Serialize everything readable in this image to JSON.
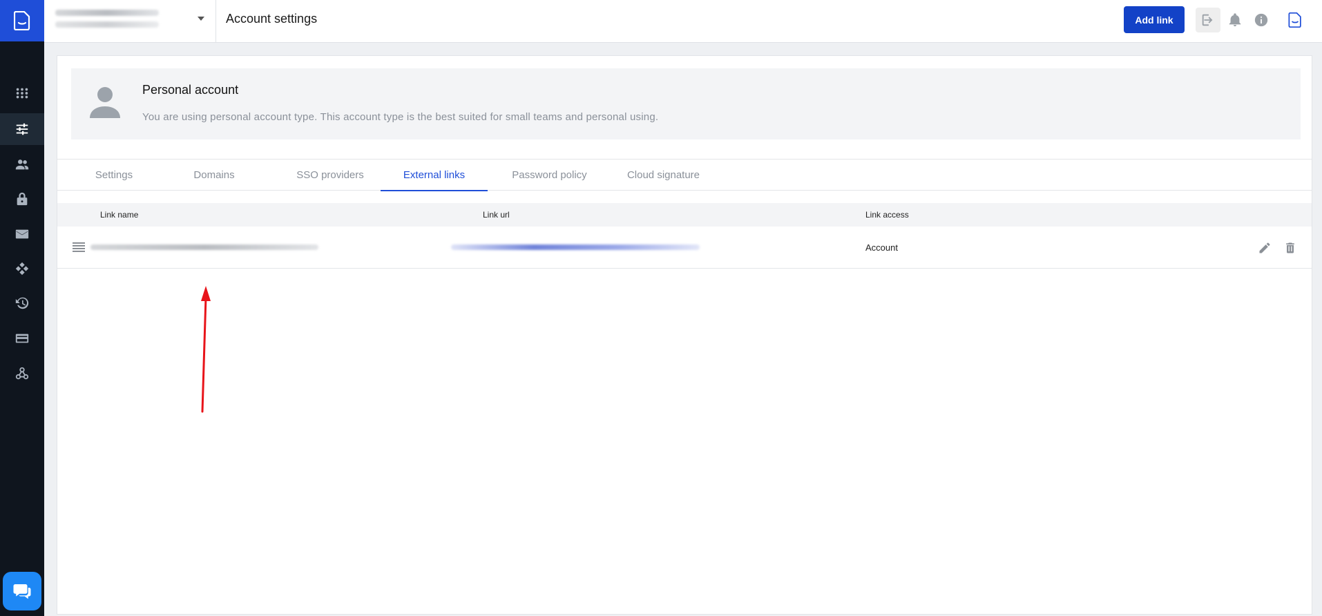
{
  "header": {
    "title": "Account settings",
    "add_link_label": "Add link"
  },
  "account": {
    "title": "Personal account",
    "description": "You are using personal account type. This account type is the best suited for small teams and personal using."
  },
  "tabs": [
    {
      "label": "Settings",
      "active": false
    },
    {
      "label": "Domains",
      "active": false
    },
    {
      "label": "SSO providers",
      "active": false
    },
    {
      "label": "External links",
      "active": true
    },
    {
      "label": "Password policy",
      "active": false
    },
    {
      "label": "Cloud signature",
      "active": false
    }
  ],
  "table": {
    "columns": [
      "Link name",
      "Link url",
      "Link access"
    ],
    "rows": [
      {
        "link_access": "Account"
      }
    ]
  },
  "sidebar_icons": [
    "apps-icon",
    "settings-sliders-icon",
    "users-icon",
    "lock-icon",
    "mail-icon",
    "integrations-icon",
    "history-icon",
    "billing-card-icon",
    "webhooks-icon"
  ],
  "colors": {
    "accent": "#1f4ed8",
    "button": "#1342c7",
    "sidebar": "#0f151e",
    "annotation_arrow": "#e8141a"
  }
}
